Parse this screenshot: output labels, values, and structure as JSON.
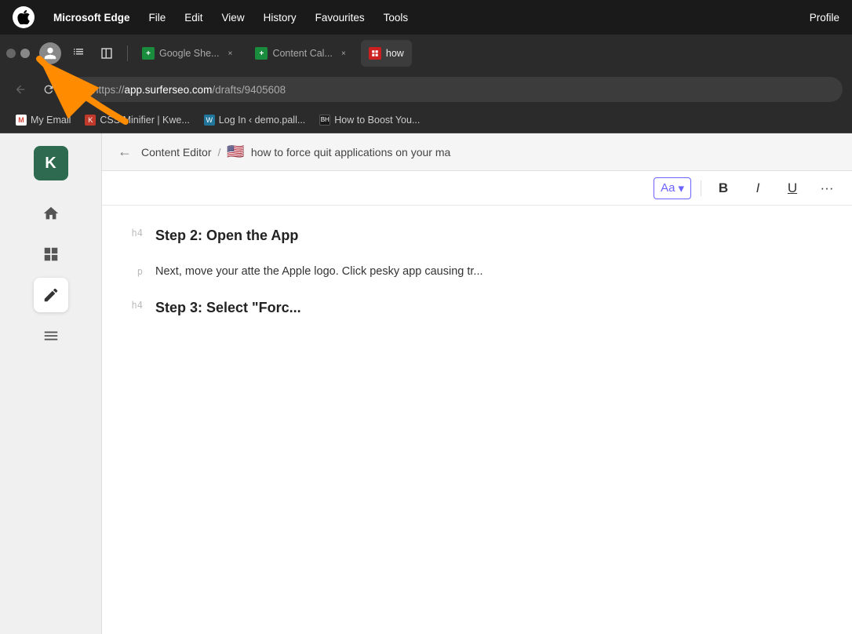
{
  "menubar": {
    "apple_label": "",
    "items": [
      {
        "label": "Microsoft Edge",
        "bold": true
      },
      {
        "label": "File"
      },
      {
        "label": "Edit"
      },
      {
        "label": "View"
      },
      {
        "label": "History"
      },
      {
        "label": "Favourites"
      },
      {
        "label": "Tools"
      },
      {
        "label": "Profile"
      }
    ]
  },
  "tabs": [
    {
      "id": "google-sheets",
      "favicon_color": "green",
      "favicon_label": "+",
      "label": "Google She...",
      "active": false,
      "has_close": true
    },
    {
      "id": "content-cal",
      "favicon_color": "green",
      "favicon_label": "+",
      "label": "Content Cal...",
      "active": false,
      "has_close": true
    },
    {
      "id": "how-to",
      "favicon_color": "red",
      "favicon_label": "📊",
      "label": "how",
      "active": true,
      "has_close": false
    }
  ],
  "address_bar": {
    "url_prefix": "https://",
    "url_domain": "app.surferseo.com",
    "url_path": "/drafts/9405608"
  },
  "bookmarks": [
    {
      "id": "gmail",
      "icon_class": "bm-gmail",
      "icon_text": "M",
      "label": "My Email"
    },
    {
      "id": "kwes",
      "icon_class": "bm-kwes",
      "icon_text": "K",
      "label": "CSS Minifier | Kwe..."
    },
    {
      "id": "wordpress",
      "icon_class": "bm-wp",
      "icon_text": "W",
      "label": "Log In ‹ demo.pall..."
    },
    {
      "id": "bh",
      "icon_class": "bm-bh",
      "icon_text": "BH",
      "label": "How to Boost You..."
    }
  ],
  "breadcrumb": {
    "back_icon": "←",
    "content_editor_label": "Content Editor",
    "separator": "/",
    "flag": "🇺🇸",
    "doc_title": "how to force quit applications on your ma"
  },
  "toolbar": {
    "font_label": "Aa",
    "chevron": "▾",
    "bold_label": "B",
    "italic_label": "I",
    "underline_label": "U"
  },
  "editor": {
    "rows": [
      {
        "tag": "h4",
        "content": "Step 2: Open the App",
        "style": "h4"
      },
      {
        "tag": "p",
        "content": "Next, move your atte the Apple logo. Click pesky app causing tr",
        "style": "p"
      },
      {
        "tag": "h4",
        "content": "Step 3: Select \"Forc",
        "style": "h4"
      }
    ]
  },
  "sidebar": {
    "logo_letter": "K",
    "items": [
      {
        "id": "home",
        "icon": "⌂",
        "active": false
      },
      {
        "id": "grid",
        "icon": "⊞",
        "active": false
      },
      {
        "id": "edit",
        "icon": "✏",
        "active": true
      },
      {
        "id": "menu",
        "icon": "☰",
        "active": false
      }
    ]
  },
  "arrow": {
    "color": "#FF8C00"
  }
}
